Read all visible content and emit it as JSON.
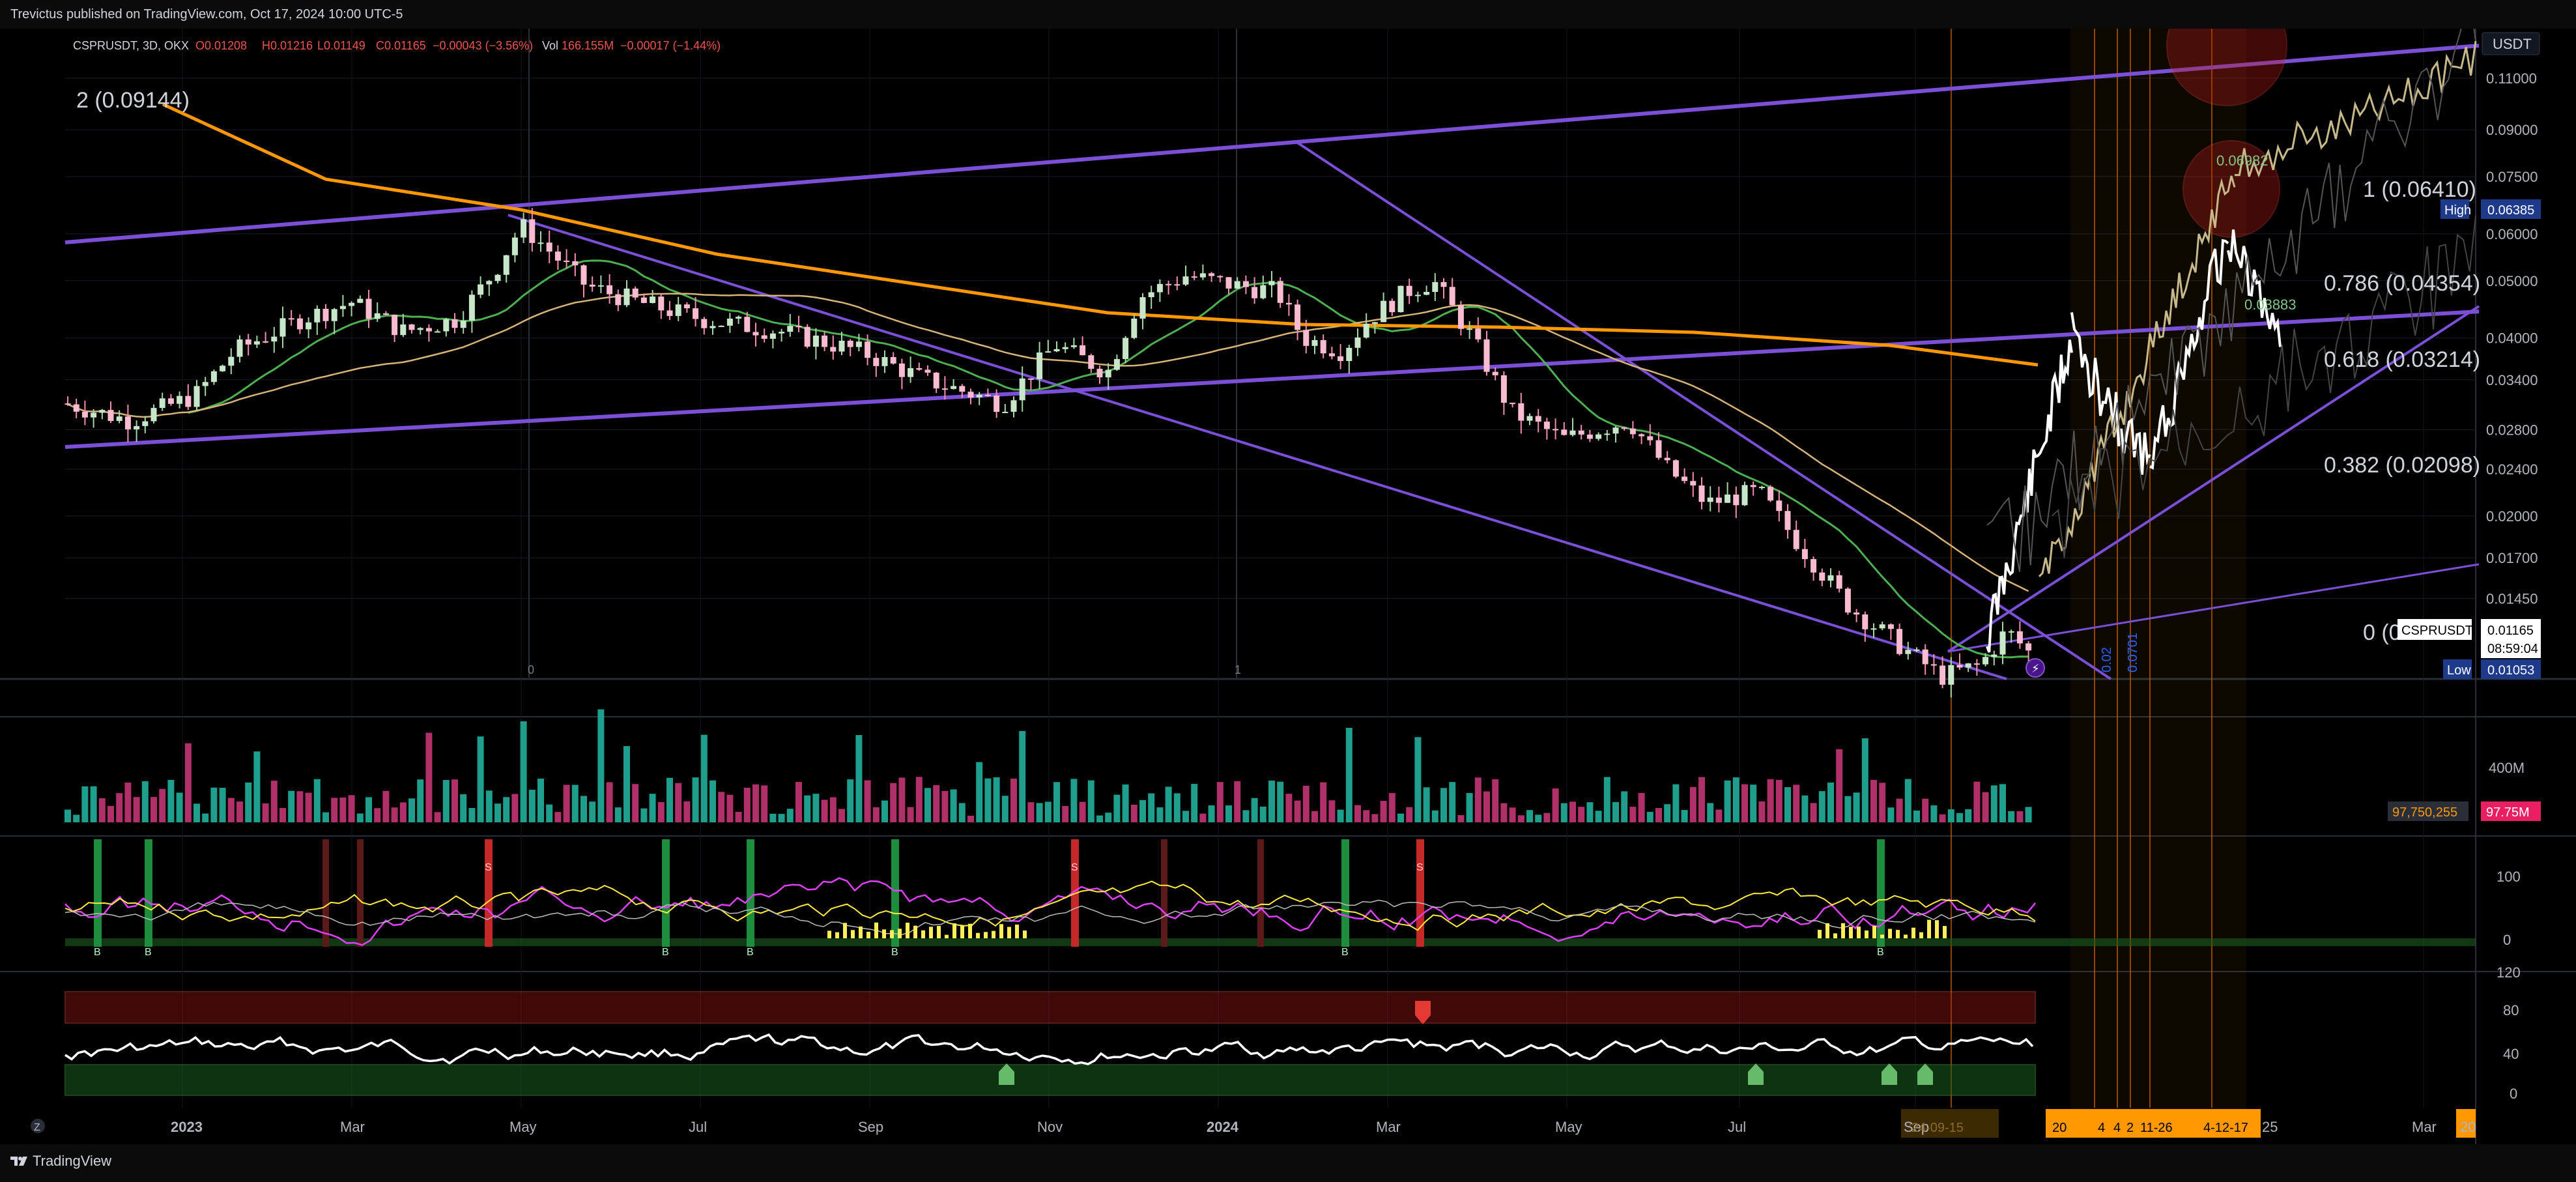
{
  "header": {
    "publisher": "Trevictus published on TradingView.com, Oct 17, 2024 10:00 UTC-5"
  },
  "footer": {
    "brand": "TradingView"
  },
  "chart_data": {
    "type": "candlestick",
    "title": "CSPRUSDT, 3D, OKX",
    "ohlc": {
      "open": "O0.01208",
      "high": "H0.01216",
      "low": "L0.01149",
      "close": "C0.01165",
      "change": "−0.00043 (−3.56%)"
    },
    "volume_label": "Vol",
    "volume_value": "166.155M",
    "volume_change": "−0.00017 (−1.44%)",
    "currency": "USDT",
    "price_axis": [
      "0.11000",
      "0.09000",
      "0.07500",
      "0.06000",
      "0.05000",
      "0.04000",
      "0.03400",
      "0.02800",
      "0.02400",
      "0.02000",
      "0.01700",
      "0.01450"
    ],
    "time_axis": [
      "2023",
      "Mar",
      "May",
      "Jul",
      "Sep",
      "Nov",
      "2024",
      "Mar",
      "May",
      "Jul",
      "Sep",
      "Mar"
    ],
    "time_axis_partial": [
      "25",
      "20"
    ],
    "time_axis_pane_letter": "Z",
    "highlighted_dates": [
      "'24-09-15",
      "20",
      "4",
      "4",
      "2",
      "11-26",
      "4-12-17"
    ],
    "cycle_marks": [
      "0",
      "1"
    ],
    "vertical_marks": [
      "0.02",
      "0.0701"
    ],
    "fib_levels": [
      {
        "label": "2 (0.09144)"
      },
      {
        "label": "1 (0.06410)"
      },
      {
        "label": "0.786 (0.04354)"
      },
      {
        "label": "0.618 (0.03214)"
      },
      {
        "label": "0.382 (0.02098)"
      },
      {
        "label": "0 (0"
      }
    ],
    "projection_labels": [
      "0.06982",
      "0.03883"
    ],
    "price_markers": {
      "high_label": "High",
      "high_value": "0.06385",
      "symbol": "CSPRUSDT",
      "last": "0.01165",
      "countdown": "08:59:04",
      "low_label": "Low",
      "low_value": "0.01053"
    },
    "volume_pane": {
      "axis": [
        "400M"
      ],
      "value": "97,750,255",
      "badge": "97.75M"
    },
    "momentum_pane": {
      "axis": [
        "100",
        "0"
      ],
      "buy_label": "B",
      "sell_label": "S"
    },
    "rsi_pane": {
      "axis": [
        "120",
        "80",
        "40",
        "0"
      ]
    },
    "colors": {
      "up": "#26a69a",
      "down": "#ef5350",
      "channel": "#7b4fd6",
      "ema_fast": "#ff9800",
      "ema_slow": "#4caf50",
      "ema_mid": "#c8a26b"
    },
    "series_trend": "downtrend from ~0.063 (Apr 2023) to ~0.0105 (Sep 2024) with projected rebound paths"
  }
}
